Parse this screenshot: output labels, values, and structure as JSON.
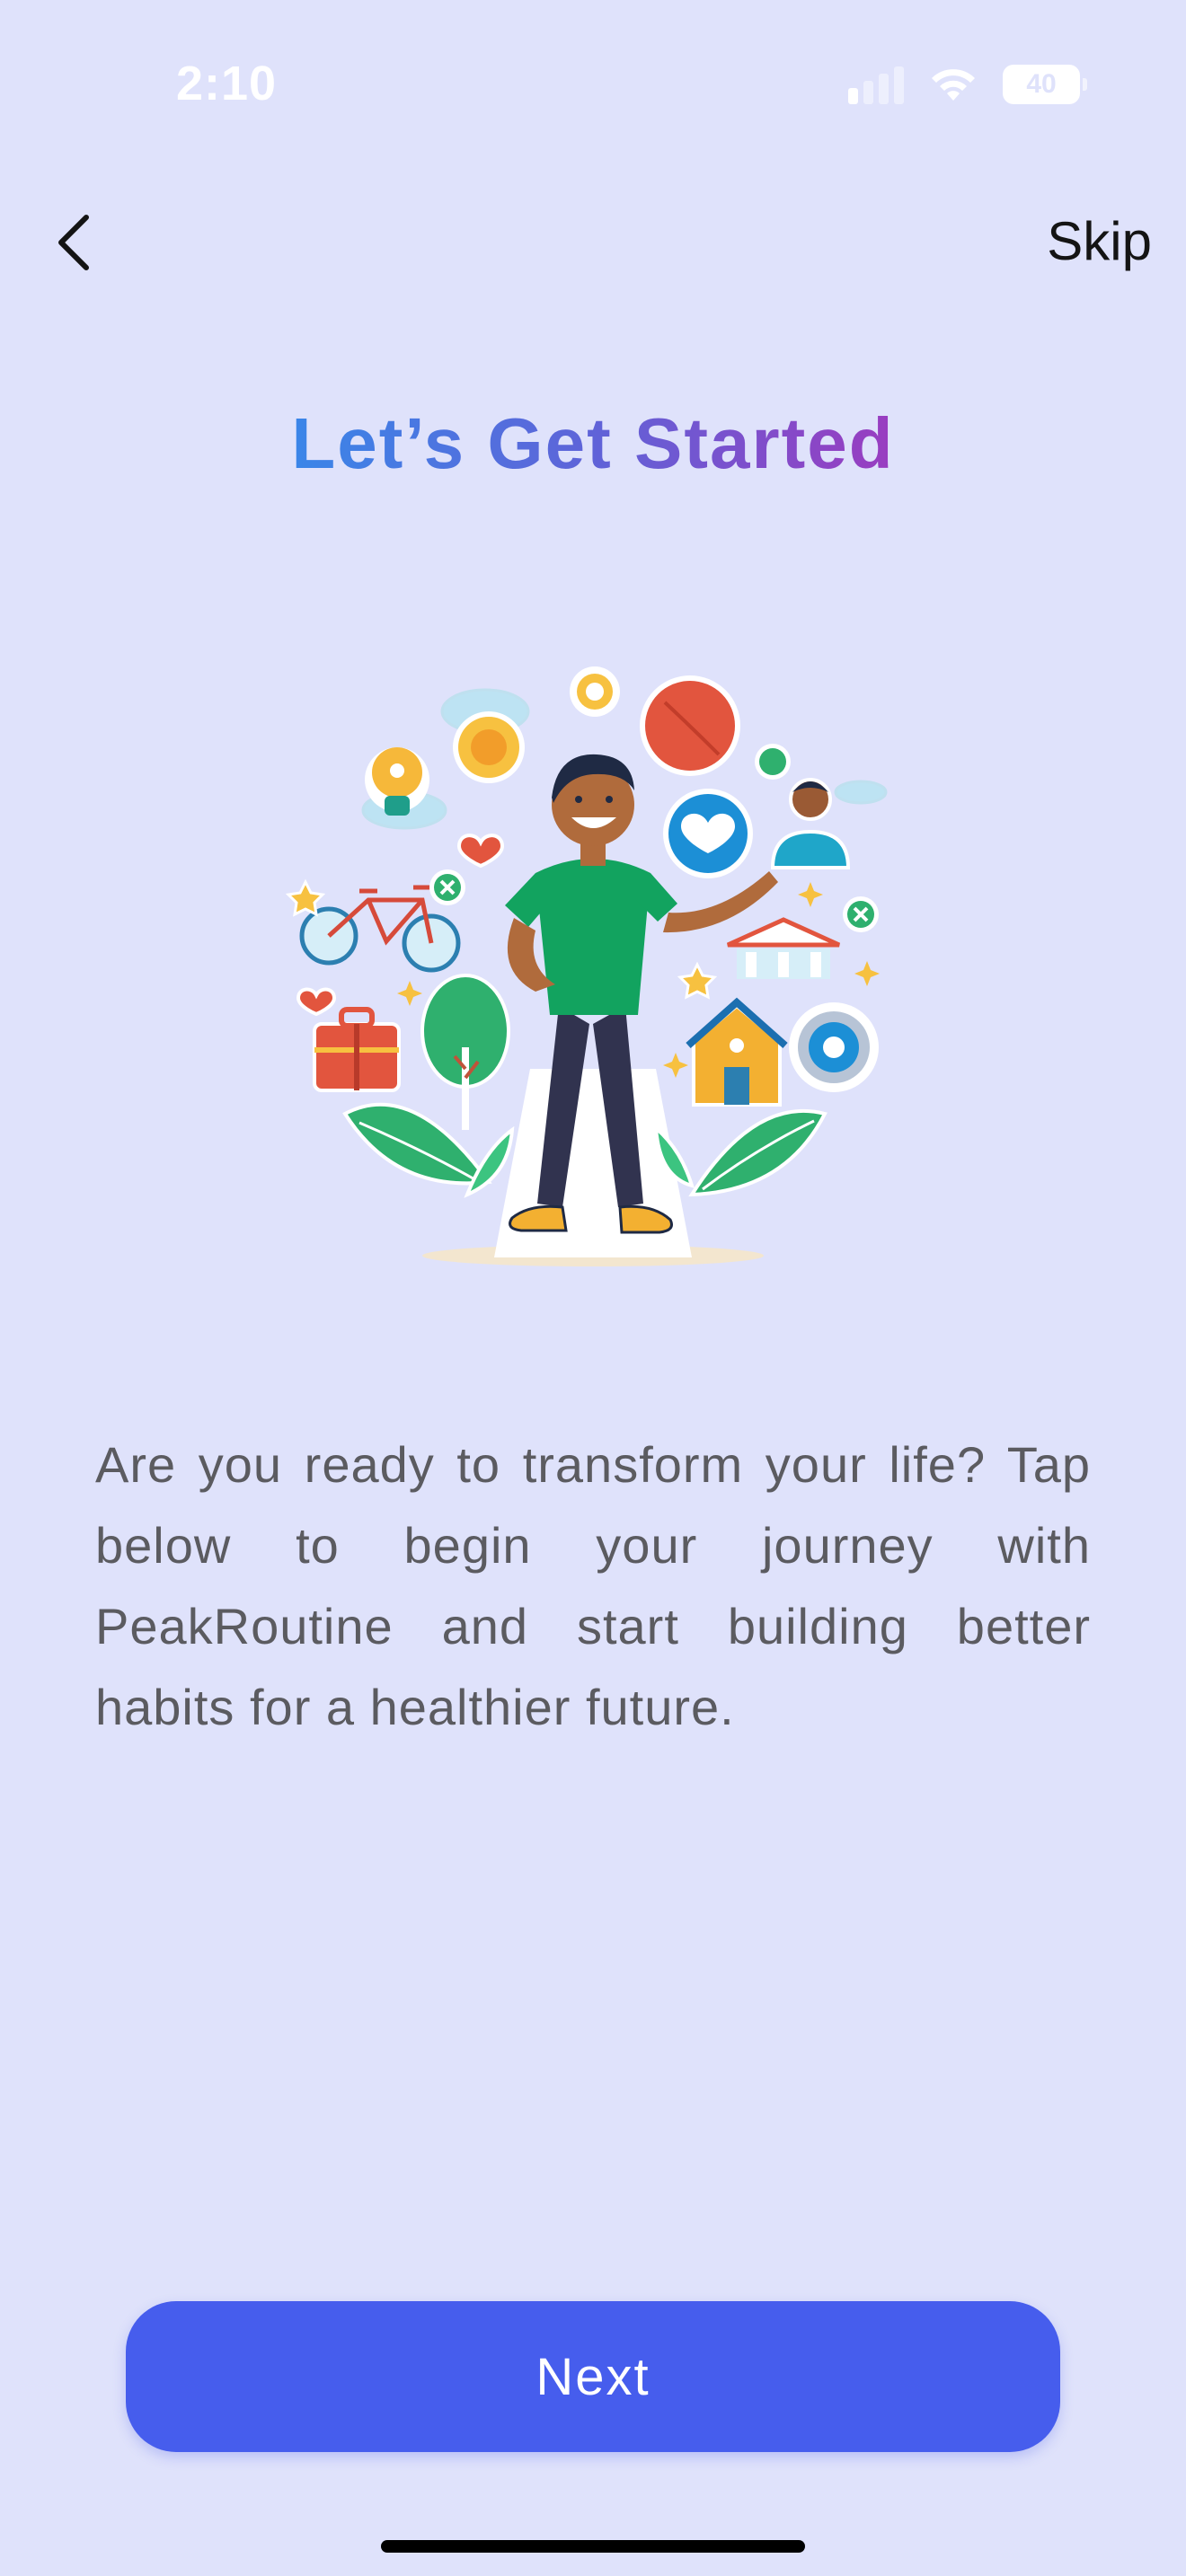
{
  "status_bar": {
    "time": "2:10",
    "battery_level": "40",
    "signal_bars_active": 1,
    "signal_icon": "cellular-signal-icon",
    "wifi_icon": "wifi-icon"
  },
  "nav": {
    "back_icon": "chevron-left-icon",
    "skip_label": "Skip"
  },
  "title": "Let’s Get Started",
  "illustration_icon": "healthy-lifestyle-illustration",
  "description": "Are you ready to transform your life? Tap below to begin your journey with PeakRoutine and start building better habits for a healthier future.",
  "next_button_label": "Next",
  "colors": {
    "background": "#dfe2fb",
    "accent": "#465ded",
    "title_gradient_start": "#3a86e8",
    "title_gradient_end": "#9a3cc0",
    "body_text": "#5b5b60"
  }
}
